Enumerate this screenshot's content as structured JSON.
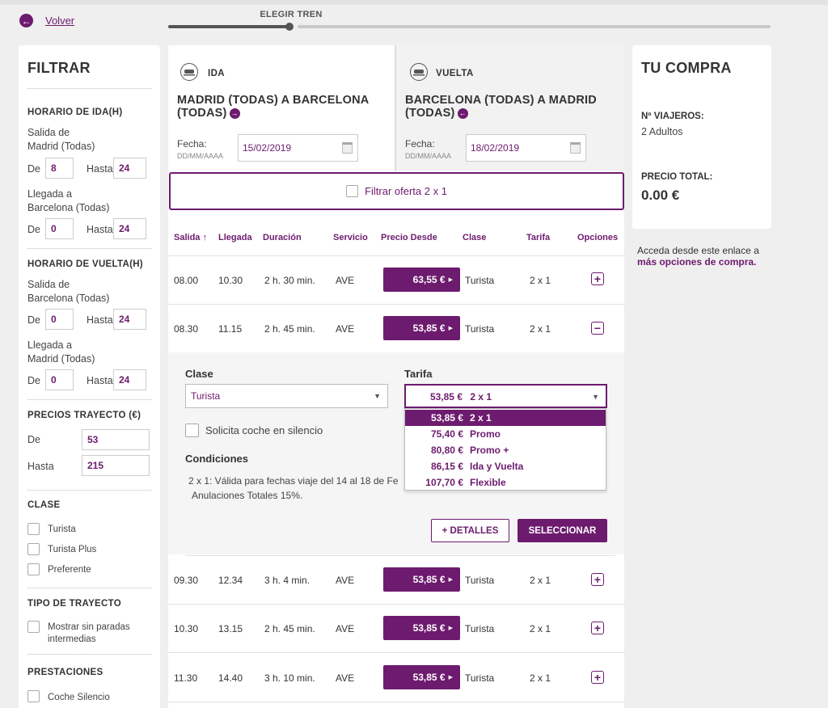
{
  "header": {
    "back_label": "Volver",
    "progress_label": "ELEGIR TREN"
  },
  "sidebar": {
    "title": "FILTRAR",
    "ida": {
      "heading": "HORARIO DE IDA(H)",
      "salida_label": "Salida de\nMadrid (Todas)",
      "salida_de_label": "De",
      "salida_de": "8",
      "salida_hasta_label": "Hasta",
      "salida_hasta": "24",
      "llegada_label": "Llegada a\nBarcelona (Todas)",
      "llegada_de_label": "De",
      "llegada_de": "0",
      "llegada_hasta_label": "Hasta",
      "llegada_hasta": "24"
    },
    "vuelta": {
      "heading": "HORARIO DE VUELTA(H)",
      "salida_label": "Salida de\nBarcelona (Todas)",
      "salida_de_label": "De",
      "salida_de": "0",
      "salida_hasta_label": "Hasta",
      "salida_hasta": "24",
      "llegada_label": "Llegada a\nMadrid (Todas)",
      "llegada_de_label": "De",
      "llegada_de": "0",
      "llegada_hasta_label": "Hasta",
      "llegada_hasta": "24"
    },
    "precios": {
      "heading": "PRECIOS TRAYECTO (€)",
      "de_label": "De",
      "de": "53",
      "hasta_label": "Hasta",
      "hasta": "215"
    },
    "clase": {
      "heading": "CLASE",
      "options": [
        "Turista",
        "Turista Plus",
        "Preferente"
      ]
    },
    "tipo": {
      "heading": "TIPO DE TRAYECTO",
      "option": "Mostrar sin paradas\nintermedias"
    },
    "prestaciones": {
      "heading": "PRESTACIONES",
      "option": "Coche Silencio"
    }
  },
  "ida": {
    "tab_label": "IDA",
    "route": "MADRID (TODAS) A BARCELONA (TODAS)",
    "route_line1": "MADRID (TODAS) A BARCELONA",
    "route_line2": "(TODAS)",
    "fecha_label": "Fecha:",
    "fecha_format": "DD/MM/AAAA",
    "fecha": "15/02/2019"
  },
  "vuelta": {
    "tab_label": "VUELTA",
    "route_line1": "BARCELONA (TODAS) A MADRID",
    "route_line2": "(TODAS)",
    "fecha_label": "Fecha:",
    "fecha_format": "DD/MM/AAAA",
    "fecha": "18/02/2019"
  },
  "filter_offer_label": "Filtrar oferta 2 x 1",
  "table": {
    "headers": {
      "salida": "Salida ↑",
      "llegada": "Llegada",
      "duracion": "Duración",
      "servicio": "Servicio",
      "precio": "Precio Desde",
      "clase": "Clase",
      "tarifa": "Tarifa",
      "opciones": "Opciones"
    },
    "rows": [
      {
        "salida": "08.00",
        "llegada": "10.30",
        "duracion": "2 h. 30 min.",
        "servicio": "AVE",
        "precio": "63,55 €",
        "clase": "Turista",
        "tarifa": "2 x 1",
        "toggle": "+"
      },
      {
        "salida": "08.30",
        "llegada": "11.15",
        "duracion": "2 h. 45 min.",
        "servicio": "AVE",
        "precio": "53,85 €",
        "clase": "Turista",
        "tarifa": "2 x 1",
        "toggle": "−"
      },
      {
        "salida": "09.30",
        "llegada": "12.34",
        "duracion": "3 h. 4 min.",
        "servicio": "AVE",
        "precio": "53,85 €",
        "clase": "Turista",
        "tarifa": "2 x 1",
        "toggle": "+"
      },
      {
        "salida": "10.30",
        "llegada": "13.15",
        "duracion": "2 h. 45 min.",
        "servicio": "AVE",
        "precio": "53,85 €",
        "clase": "Turista",
        "tarifa": "2 x 1",
        "toggle": "+"
      },
      {
        "salida": "11.30",
        "llegada": "14.40",
        "duracion": "3 h. 10 min.",
        "servicio": "AVE",
        "precio": "53,85 €",
        "clase": "Turista",
        "tarifa": "2 x 1",
        "toggle": "+"
      }
    ]
  },
  "details": {
    "clase_label": "Clase",
    "clase_value": "Turista",
    "tarifa_label": "Tarifa",
    "tarifa_price": "53,85 €",
    "tarifa_name": "2 x 1",
    "tarifa_options": [
      {
        "price": "53,85 €",
        "name": "2 x 1"
      },
      {
        "price": "75,40 €",
        "name": "Promo"
      },
      {
        "price": "80,80 €",
        "name": "Promo +"
      },
      {
        "price": "86,15 €",
        "name": "Ida y Vuelta"
      },
      {
        "price": "107,70 €",
        "name": "Flexible"
      }
    ],
    "silencio_label": "Solicita coche en silencio",
    "condiciones_label": "Condiciones",
    "condiciones_line1": "2 x 1:  Válida para fechas viaje del 14 al 18 de Fe",
    "condiciones_line2": "Anulaciones Totales 15%.",
    "detalles_button": "+ DETALLES",
    "seleccionar_button": "SELECCIONAR"
  },
  "summary": {
    "title": "TU COMPRA",
    "viajeros_label": "Nº VIAJEROS:",
    "viajeros_value": "2 Adultos",
    "precio_label": "PRECIO TOTAL:",
    "precio_value": "0.00 €",
    "more_text": "Acceda desde este enlace a",
    "more_link": "más opciones de compra."
  },
  "colors": {
    "accent": "#6d1b6e",
    "background": "#efefef"
  }
}
